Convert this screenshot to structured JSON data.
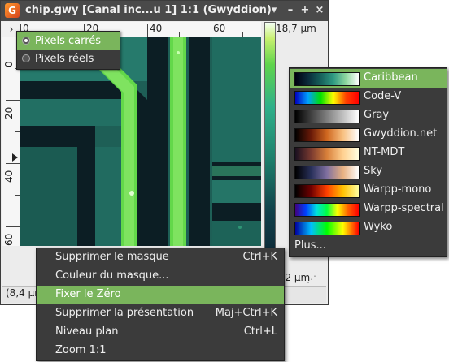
{
  "window": {
    "title": "chip.gwy [Canal inc...u 1] 1:1 (Gwyddion)",
    "app_icon_letter": "G",
    "controls": {
      "menu": "▾",
      "minimize": "–",
      "maximize": "+",
      "close": "×"
    }
  },
  "rulers": {
    "horizontal_labels": [
      "0",
      "20",
      "40",
      "60"
    ],
    "vertical_labels": [
      "0 µm",
      "20",
      "40",
      "60"
    ],
    "corner": "›"
  },
  "colorbar": {
    "max": "18,7 µm",
    "min": "4,2 µm"
  },
  "status": {
    "text": "(8,4 µm"
  },
  "mask_menu": {
    "items": [
      {
        "label": "Pixels carrés",
        "selected": true
      },
      {
        "label": "Pixels réels",
        "selected": false
      }
    ]
  },
  "gradient_menu": {
    "items": [
      {
        "label": "Caribbean",
        "selected": true
      },
      {
        "label": "Code-V"
      },
      {
        "label": "Gray"
      },
      {
        "label": "Gwyddion.net"
      },
      {
        "label": "NT-MDT"
      },
      {
        "label": "Sky"
      },
      {
        "label": "Warpp-mono"
      },
      {
        "label": "Warpp-spectral"
      },
      {
        "label": "Wyko"
      }
    ],
    "more": "Plus..."
  },
  "context_menu": {
    "items": [
      {
        "label": "Supprimer le masque",
        "accel": "Ctrl+K"
      },
      {
        "label": "Couleur du masque...",
        "accel": ""
      },
      {
        "label": "Fixer le Zéro",
        "accel": "",
        "selected": true
      },
      {
        "label": "Supprimer la présentation",
        "accel": "Maj+Ctrl+K"
      },
      {
        "label": "Niveau plan",
        "accel": "Ctrl+L"
      },
      {
        "label": "Zoom 1:1",
        "accel": ""
      }
    ]
  },
  "colors": {
    "menu_bg": "#3b3b3b",
    "highlight": "#7ab55c",
    "titlebar": "#4a4a4a"
  }
}
